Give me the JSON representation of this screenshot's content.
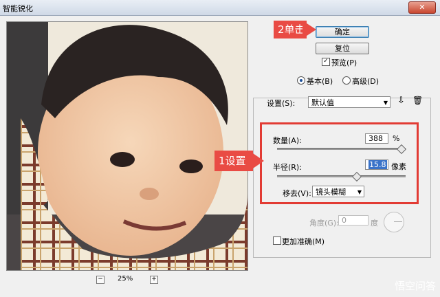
{
  "window": {
    "title": "智能锐化",
    "close_label": "✕"
  },
  "preview": {
    "zoom_out": "−",
    "zoom_value": "25%",
    "zoom_in": "+"
  },
  "buttons": {
    "ok": "确定",
    "reset": "复位"
  },
  "preview_checkbox": {
    "label": "预览(P)",
    "checked": true
  },
  "mode": {
    "basic": "基本(B)",
    "advanced": "高级(D)",
    "selected": "basic"
  },
  "settings": {
    "label": "设置(S):",
    "value": "默认值",
    "amount_label": "数量(A):",
    "amount_value": "388",
    "amount_unit": "%",
    "amount_level": 0.97,
    "radius_label": "半径(R):",
    "radius_value": "15.8",
    "radius_unit": "像素",
    "radius_level": 0.62,
    "remove_label": "移去(V):",
    "remove_value": "镜头模糊",
    "angle_label": "角度(G):",
    "angle_value": "0",
    "angle_unit": "度",
    "more_accurate": "更加准确(M)"
  },
  "annotations": {
    "step2": "2单击",
    "step1": "1设置"
  },
  "watermark": "悟空问答"
}
